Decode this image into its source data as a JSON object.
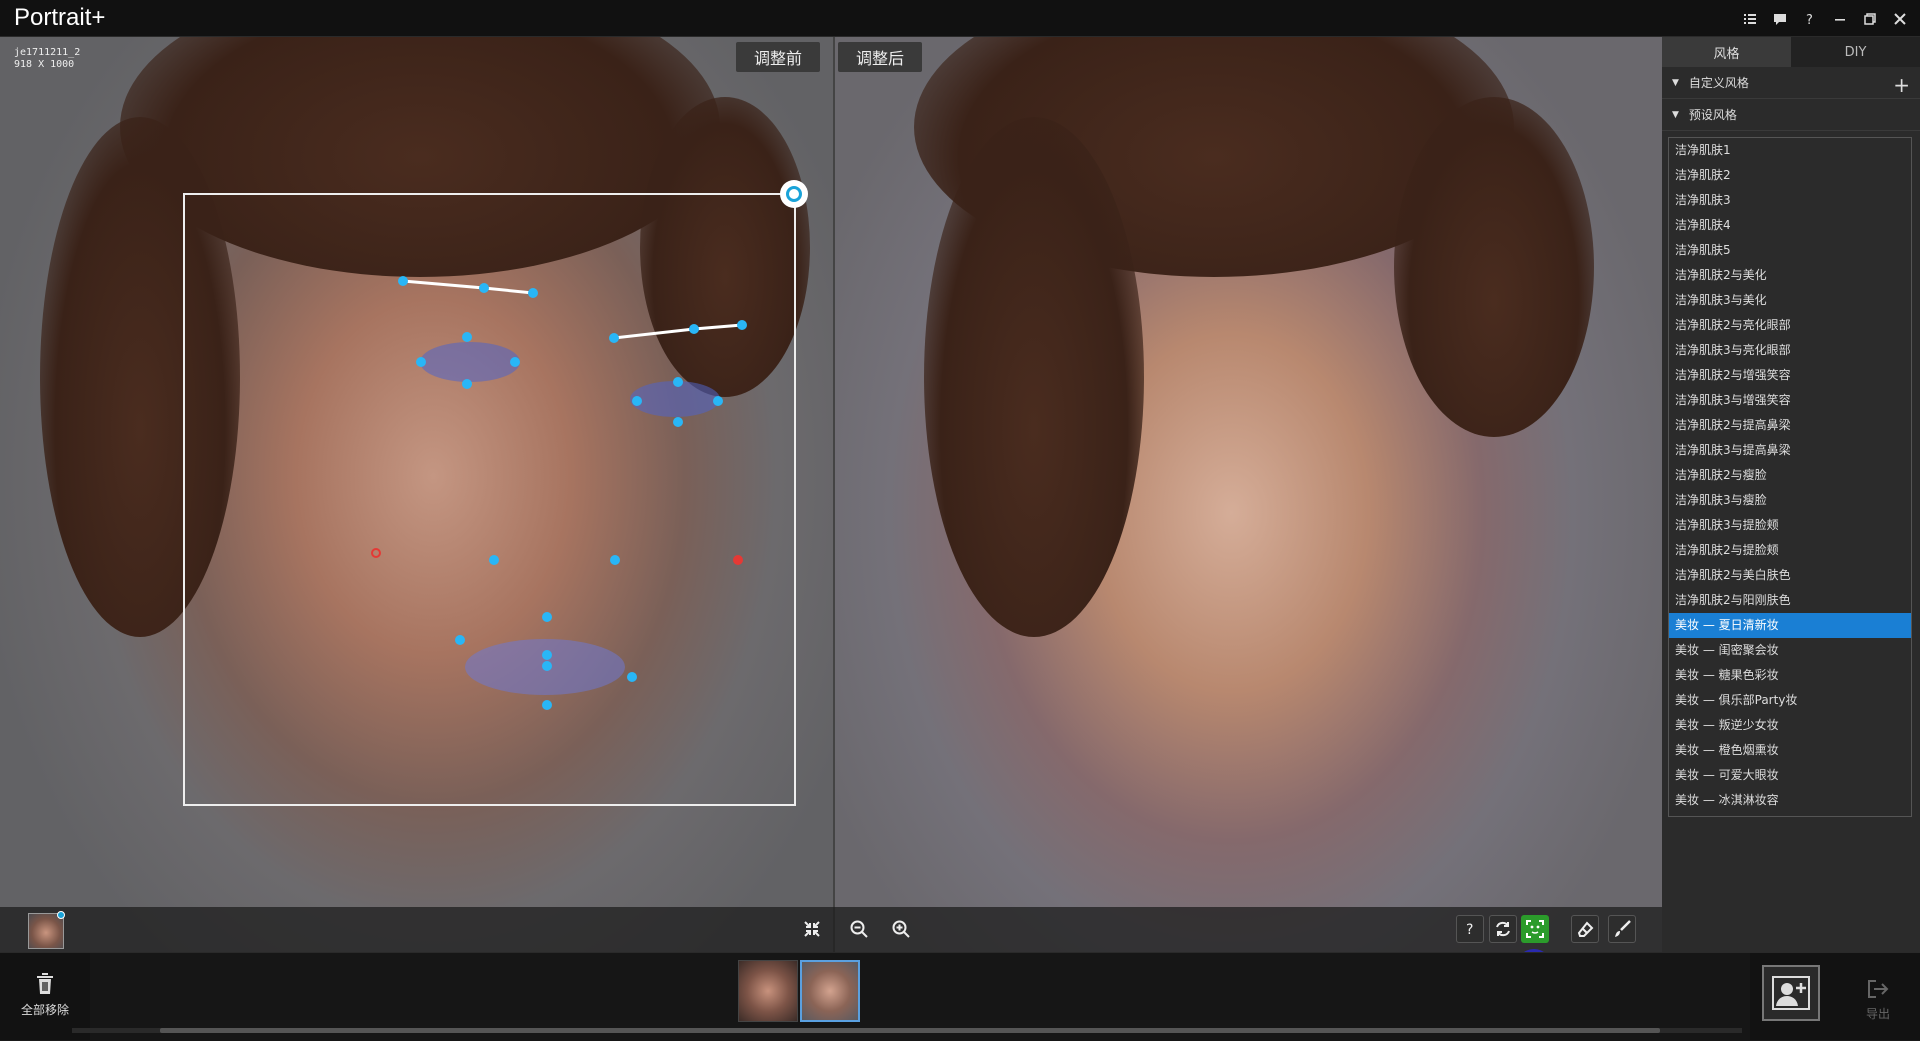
{
  "app": {
    "title": "Portrait+"
  },
  "window_controls": [
    "menu-icon",
    "feedback-icon",
    "help-icon",
    "minimize-icon",
    "restore-icon",
    "close-icon"
  ],
  "image_info": {
    "filename": "je1711211_2",
    "dimensions": "918 X 1000"
  },
  "compare": {
    "before_label": "调整前",
    "after_label": "调整后"
  },
  "toolbar": {
    "left": [
      "fit-screen-icon",
      "zoom-out-icon",
      "zoom-in-icon"
    ],
    "right": [
      "help-icon",
      "refresh-icon",
      "face-detect-icon",
      "eraser-icon",
      "brush-icon"
    ],
    "active_tool": "face-detect-icon"
  },
  "right_panel": {
    "tabs": [
      {
        "label": "风格",
        "active": true
      },
      {
        "label": "DIY",
        "active": false
      }
    ],
    "sections": {
      "custom": "自定义风格",
      "preset": "预设风格"
    },
    "styles": [
      "洁净肌肤1",
      "洁净肌肤2",
      "洁净肌肤3",
      "洁净肌肤4",
      "洁净肌肤5",
      "洁净肌肤2与美化",
      "洁净肌肤3与美化",
      "洁净肌肤2与亮化眼部",
      "洁净肌肤3与亮化眼部",
      "洁净肌肤2与增强笑容",
      "洁净肌肤3与增强笑容",
      "洁净肌肤2与提高鼻梁",
      "洁净肌肤3与提高鼻梁",
      "洁净肌肤2与瘦脸",
      "洁净肌肤3与瘦脸",
      "洁净肌肤3与提脸颊",
      "洁净肌肤2与提脸颊",
      "洁净肌肤2与美白肤色",
      "洁净肌肤2与阳刚肤色",
      "美妆 — 夏日清新妆",
      "美妆 — 闺密聚会妆",
      "美妆 — 糖果色彩妆",
      "美妆 — 俱乐部Party妆",
      "美妆 — 叛逆少女妆",
      "美妆 — 橙色烟熏妆",
      "美妆 — 可爱大眼妆",
      "美妆 — 冰淇淋妆容"
    ],
    "selected_index": 19
  },
  "bottom": {
    "remove_all": "全部移除",
    "export": "导出"
  },
  "colors": {
    "accent": "#1a7fd4",
    "handle": "#1aa3d9",
    "green": "#2b9b2b",
    "landmark": "#29b6f6",
    "landmark_red": "#e53935"
  }
}
